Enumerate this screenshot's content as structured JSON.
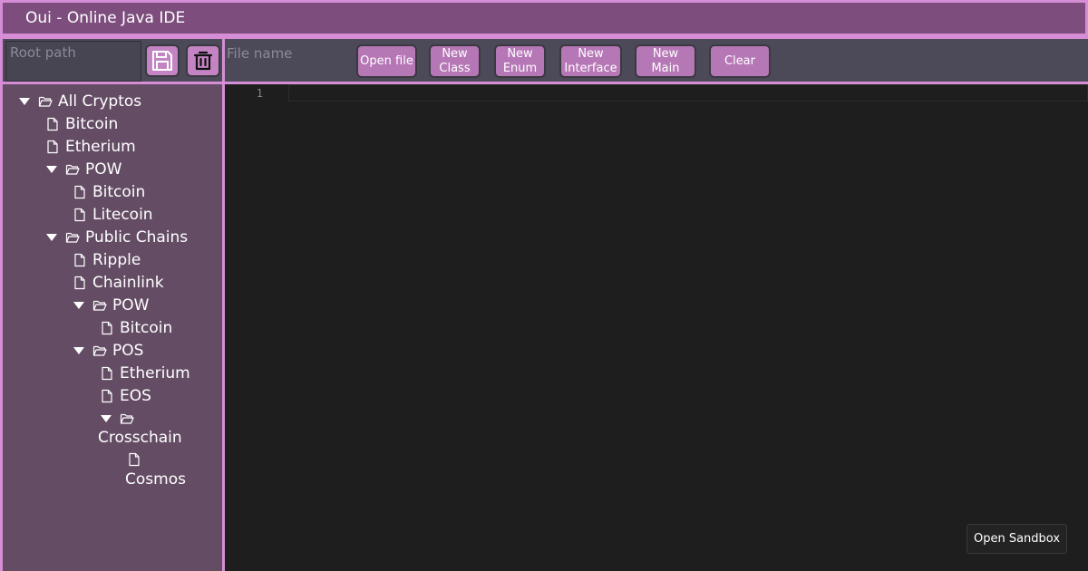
{
  "window": {
    "title": "Oui - Online Java IDE"
  },
  "root_path": {
    "placeholder": "Root path",
    "value": ""
  },
  "file_name": {
    "placeholder": "File name",
    "value": ""
  },
  "toolbar": {
    "buttons": [
      {
        "label": "Open file"
      },
      {
        "label": "New\nClass"
      },
      {
        "label": "New\nEnum"
      },
      {
        "label": "New\nInterface"
      },
      {
        "label": "New\nMain"
      },
      {
        "label": "Clear"
      }
    ],
    "save_icon": "floppy-disk-icon",
    "delete_icon": "trash-icon"
  },
  "tree": {
    "items": [
      {
        "label": "All Cryptos",
        "type": "folder"
      },
      {
        "label": "Bitcoin",
        "type": "file"
      },
      {
        "label": "Etherium",
        "type": "file"
      },
      {
        "label": "POW",
        "type": "folder"
      },
      {
        "label": "Bitcoin",
        "type": "file"
      },
      {
        "label": "Litecoin",
        "type": "file"
      },
      {
        "label": "Public Chains",
        "type": "folder"
      },
      {
        "label": "Ripple",
        "type": "file"
      },
      {
        "label": "Chainlink",
        "type": "file"
      },
      {
        "label": "POW",
        "type": "folder"
      },
      {
        "label": "Bitcoin",
        "type": "file"
      },
      {
        "label": "POS",
        "type": "folder"
      },
      {
        "label": "Etherium",
        "type": "file"
      },
      {
        "label": "EOS",
        "type": "file"
      },
      {
        "label": "Crosschain",
        "type": "folder"
      },
      {
        "label": "Cosmos",
        "type": "file"
      }
    ]
  },
  "editor": {
    "line_numbers": [
      "1"
    ],
    "content": ""
  },
  "sandbox": {
    "label": "Open Sandbox"
  },
  "colors": {
    "accent_border": "#d58ed5",
    "titlebar_bg": "#7d4e7d",
    "button_bg": "#b677b6",
    "sidebar_bg": "#644d64",
    "editor_bg": "#1e1e1e"
  }
}
